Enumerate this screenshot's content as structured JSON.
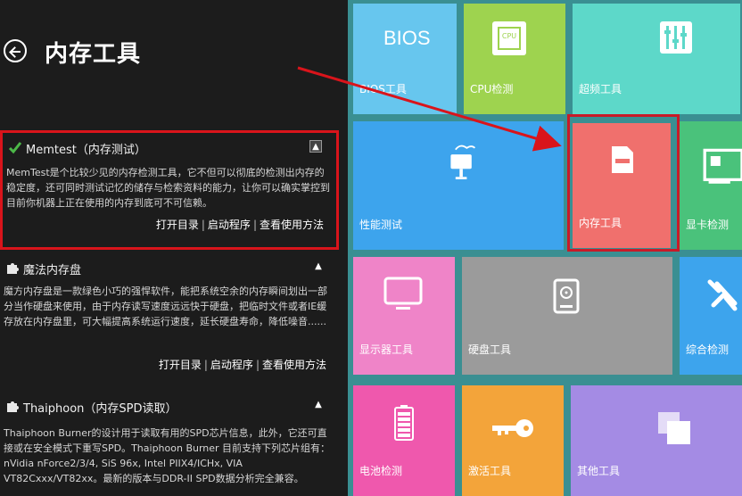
{
  "panel": {
    "title": "内存工具"
  },
  "tools": {
    "memtest": {
      "name": "Memtest（内存测试）",
      "desc": "MemTest是个比较少见的内存检测工具，它不但可以彻底的检测出内存的稳定度，还可同时测试记忆的储存与检索资料的能力，让你可以确实掌控到目前你机器上正在使用的内存到底可不可信赖。",
      "links": [
        "打开目录",
        "启动程序",
        "查看使用方法"
      ]
    },
    "magic": {
      "name": "魔法内存盘",
      "desc": "魔方内存盘是一款绿色小巧的强悍软件，能把系统空余的内存瞬间划出一部分当作硬盘来使用，由于内存读写速度远远快于硬盘，把临时文件或者IE缓存放在内存盘里，可大幅提高系统运行速度，延长硬盘寿命，降低噪音......",
      "links": [
        "打开目录",
        "启动程序",
        "查看使用方法"
      ]
    },
    "thaiphoon": {
      "name": "Thaiphoon（内存SPD读取）",
      "desc": "Thaiphoon Burner的设计用于读取有用的SPD芯片信息，此外，它还可直接或在安全模式下重写SPD。Thaiphoon Burner 目前支持下列芯片组有：nVidia nForce2/3/4, SiS 96x, Intel PIIX4/ICHx, VIA VT82Cxxx/VT82xx。最新的版本与DDR-II SPD数据分析完全兼容。"
    }
  },
  "tiles": {
    "bios": {
      "label": "BIOS工具",
      "icon_text": "BIOS"
    },
    "cpu": {
      "label": "CPU检测",
      "icon_text": "CPU"
    },
    "freq": {
      "label": "超频工具"
    },
    "perf": {
      "label": "性能测试"
    },
    "mem": {
      "label": "内存工具"
    },
    "gpu": {
      "label": "显卡检测"
    },
    "display": {
      "label": "显示器工具"
    },
    "disk": {
      "label": "硬盘工具"
    },
    "general": {
      "label": "综合检测"
    },
    "battery": {
      "label": "电池检测"
    },
    "activate": {
      "label": "激活工具"
    },
    "other": {
      "label": "其他工具"
    }
  },
  "icons": {
    "back": "back-arrow-icon",
    "memtest": "memtest-check-icon",
    "magic": "puzzle-icon",
    "thaiphoon": "puzzle-icon",
    "chevron": "chevron-up-icon"
  },
  "colors": {
    "panel_bg": "#1c1c1c",
    "highlight": "#d9141b",
    "bios": "#67c6ee",
    "cpu": "#9ed34f",
    "freq": "#5dd8c9",
    "perf": "#3da4ed",
    "mem": "#f0706d",
    "gpu": "#4ac27b",
    "display": "#ef84c8",
    "disk": "#9b9b9b",
    "general": "#3da4ed",
    "battery": "#ef58ad",
    "activate": "#f3a43a",
    "other": "#a48be4"
  }
}
